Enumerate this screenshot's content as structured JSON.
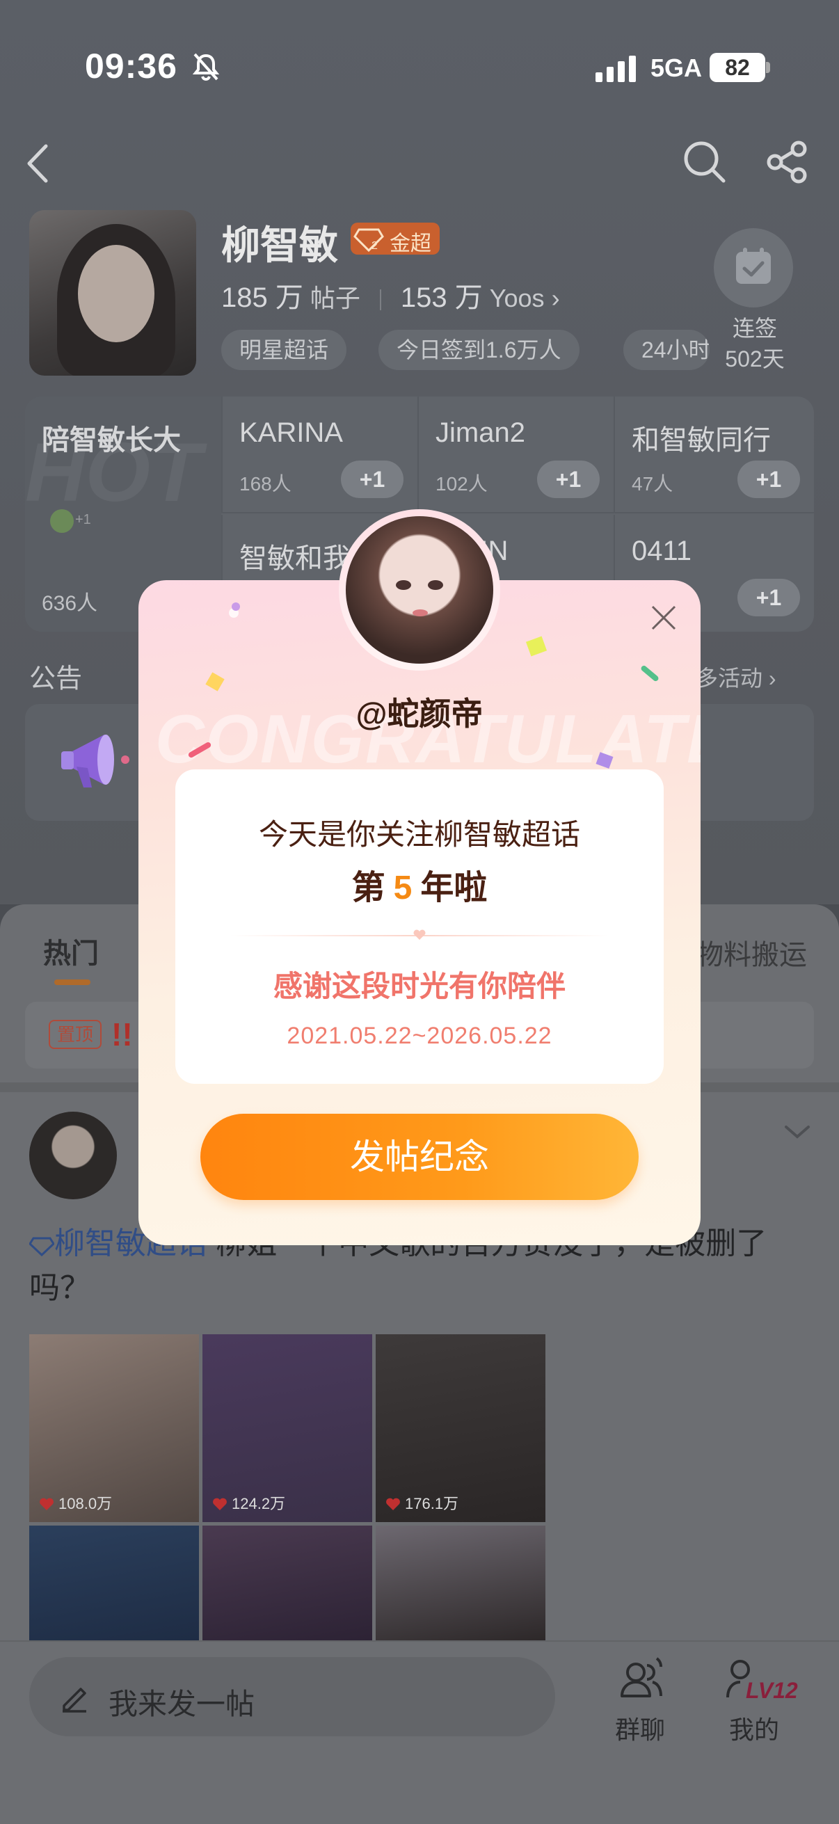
{
  "status_bar": {
    "time": "09:36",
    "network": "5GA",
    "battery": "82"
  },
  "topic": {
    "title": "柳智敏",
    "badge": "金超",
    "posts_count": "185 万",
    "posts_label": "帖子",
    "followers_count": "153 万",
    "followers_label": "Yoos",
    "followers_chevron": "›",
    "tags": [
      "明星超话",
      "今日签到1.6万人",
      "24小时"
    ],
    "checkin_label": "连签",
    "checkin_days": "502天"
  },
  "groups": {
    "first": {
      "name": "陪智敏长大",
      "count": "636人",
      "plus_small": "+1"
    },
    "cells": [
      {
        "name": "KARINA",
        "count": "168人",
        "plus": "+1"
      },
      {
        "name": "Jiman2",
        "count": "102人",
        "plus": "+1"
      },
      {
        "name": "和智敏同行",
        "count": "47人",
        "plus": "+1"
      },
      {
        "name": "智敏和我",
        "count": "",
        "plus": ""
      },
      {
        "name": "JIMIN",
        "count": "",
        "plus": ""
      },
      {
        "name": "0411",
        "count": "",
        "plus": "+1"
      }
    ]
  },
  "notice": {
    "label": "公告",
    "more": "多活动 ›"
  },
  "tabs": {
    "hot": "热门",
    "material": "物料搬运"
  },
  "pinned": {
    "badge": "置顶",
    "mark": "!!"
  },
  "post": {
    "topic_link": "柳智敏超话",
    "text_visible": "柳姐一个中文歌的百万赞没了，是被删了吗？",
    "photos": [
      {
        "meta": "108.0万"
      },
      {
        "meta": "124.2万"
      },
      {
        "meta": "176.1万"
      },
      {
        "meta": ""
      },
      {
        "meta": ""
      },
      {
        "meta": ""
      }
    ]
  },
  "bottom_bar": {
    "compose_placeholder": "我来发一帖",
    "group_chat": "群聊",
    "mine": "我的",
    "level": "LV12"
  },
  "modal": {
    "bg_text": "CONGRATULATE",
    "username": "@蛇颜帝",
    "line1": "今天是你关注柳智敏超话",
    "line2_prefix": "第",
    "line2_year": "5",
    "line2_suffix": "年啦",
    "thanks": "感谢这段时光有你陪伴",
    "dates": "2021.05.22~2026.05.22",
    "button": "发帖纪念"
  },
  "colors": {
    "accent_orange": "#ff9a1a",
    "modal_text_brown": "#4a2012",
    "thanks_pink": "#f0746a"
  }
}
